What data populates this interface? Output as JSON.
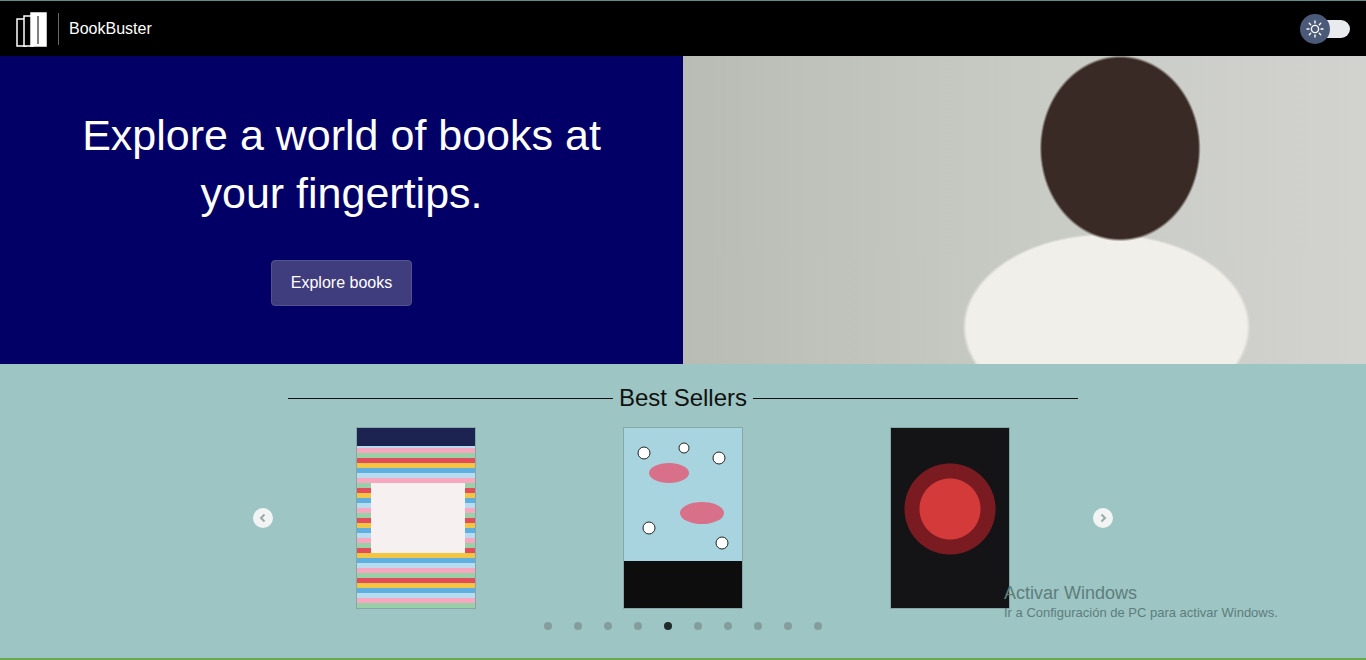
{
  "navbar": {
    "brand": "BookBuster",
    "theme_toggle": {
      "dark_mode": false
    }
  },
  "hero": {
    "heading": "Explore a world of books at your fingertips.",
    "button": "Explore books"
  },
  "best_sellers": {
    "title": "Best Sellers",
    "books": [
      {
        "kind": "stripes"
      },
      {
        "kind": "birds"
      },
      {
        "kind": "horror"
      }
    ],
    "indicators": [
      {
        "selected": false
      },
      {
        "selected": false
      },
      {
        "selected": false
      },
      {
        "selected": false
      },
      {
        "selected": true
      },
      {
        "selected": false
      },
      {
        "selected": false
      },
      {
        "selected": false
      },
      {
        "selected": false
      },
      {
        "selected": false
      }
    ]
  },
  "watermark": {
    "title": "Activar Windows",
    "subtitle": "Ir a Configuración de PC para activar Windows."
  }
}
